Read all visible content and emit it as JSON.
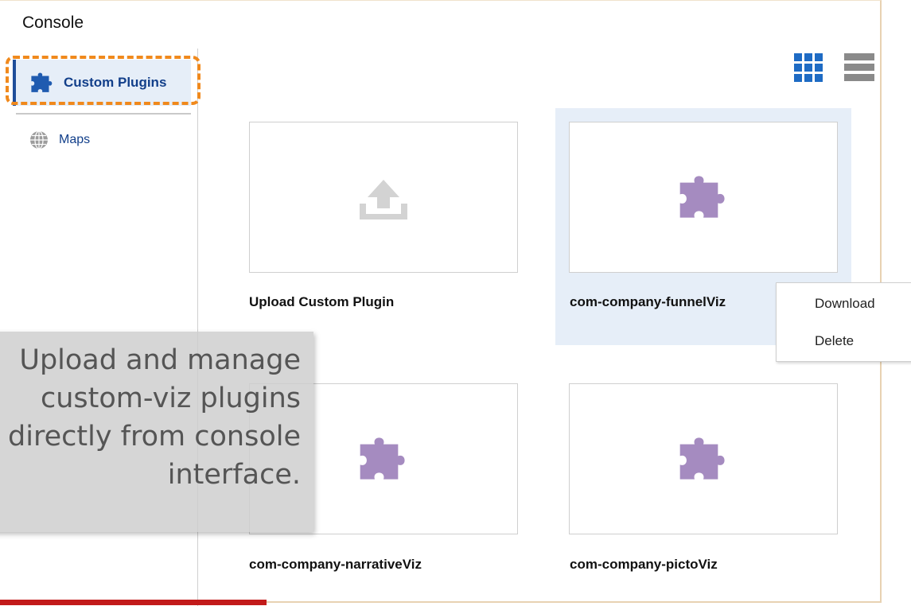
{
  "header": {
    "title": "Console"
  },
  "sidebar": {
    "items": [
      {
        "label": "Custom Plugins",
        "icon": "puzzle-icon",
        "selected": true
      },
      {
        "label": "Maps",
        "icon": "globe-icon"
      }
    ]
  },
  "toolbar": {
    "views": [
      {
        "name": "grid-view",
        "icon": "grid-icon",
        "active": true
      },
      {
        "name": "list-view",
        "icon": "list-icon"
      }
    ]
  },
  "cards": [
    {
      "label": "Upload Custom Plugin",
      "icon": "upload-icon"
    },
    {
      "label": "com-company-funnelViz",
      "icon": "puzzle-icon",
      "selected": true
    },
    {
      "label": "com-company-narrativeViz",
      "icon": "puzzle-icon"
    },
    {
      "label": "com-company-pictoViz",
      "icon": "puzzle-icon"
    }
  ],
  "context_menu": {
    "items": [
      "Download",
      "Delete"
    ]
  },
  "callout": {
    "text": "Upload and manage custom-viz plugins directly from console interface."
  },
  "colors": {
    "accent": "#1f4e9a",
    "highlight": "#f0891c",
    "selected_bg": "#e6eef8",
    "puzzle": "#a58bc0",
    "grid_icon": "#1e6bc4",
    "list_icon": "#8a8a8a"
  }
}
